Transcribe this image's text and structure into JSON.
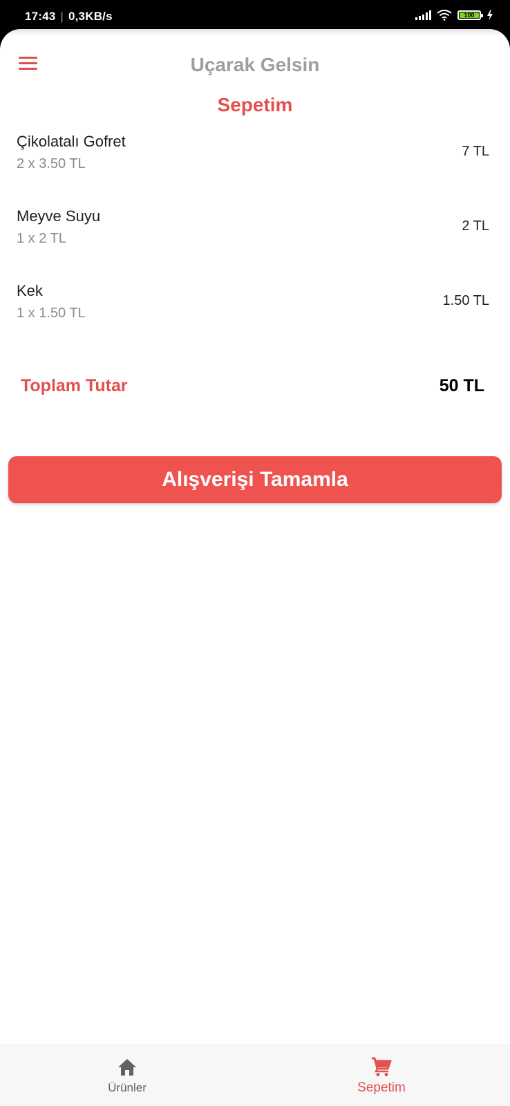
{
  "status_bar": {
    "time": "17:43",
    "separator": "|",
    "network_speed": "0,3KB/s",
    "battery_level": "100",
    "battery_fraction": 1.0,
    "icons": [
      "signal-icon",
      "wifi-icon",
      "battery-icon",
      "charging-icon"
    ]
  },
  "header": {
    "app_title": "Uçarak Gelsin",
    "menu_icon": "hamburger-menu-icon"
  },
  "page": {
    "title": "Sepetim"
  },
  "cart": {
    "items": [
      {
        "name": "Çikolatalı Gofret",
        "quantity_line": "2 x 3.50 TL",
        "price": "7 TL"
      },
      {
        "name": "Meyve Suyu",
        "quantity_line": "1 x 2 TL",
        "price": "2 TL"
      },
      {
        "name": "Kek",
        "quantity_line": "1 x 1.50 TL",
        "price": "1.50 TL"
      }
    ],
    "total_label": "Toplam Tutar",
    "total_value": "50 TL"
  },
  "checkout_button_label": "Alışverişi Tamamla",
  "bottom_nav": {
    "tabs": [
      {
        "label": "Ürünler",
        "icon": "home-icon",
        "active": false
      },
      {
        "label": "Sepetim",
        "icon": "shopping-cart-icon",
        "active": true
      }
    ]
  },
  "colors": {
    "accent": "#e2504c",
    "button": "#ef5350",
    "title_gray": "#9e9e9e",
    "text_dark": "#1f1f1f",
    "text_muted": "#8a8a8a",
    "nav_background": "#f7f7f7"
  }
}
